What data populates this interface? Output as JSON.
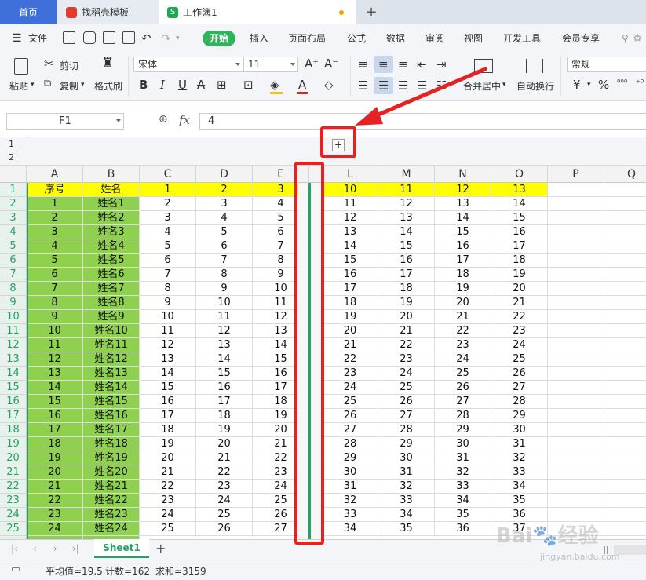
{
  "titlebar": {
    "tabs": [
      {
        "label": "首页"
      },
      {
        "label": "找稻壳模板"
      },
      {
        "label": "工作簿1"
      }
    ],
    "new_tab": "+"
  },
  "menu": {
    "file": "文件",
    "items": [
      "开始",
      "插入",
      "页面布局",
      "公式",
      "数据",
      "审阅",
      "视图",
      "开发工具",
      "会员专享"
    ],
    "search_partial": "查"
  },
  "ribbon": {
    "paste": "粘贴",
    "cut": "剪切",
    "copy": "复制",
    "format_painter": "格式刷",
    "font_name": "宋体",
    "font_size": "11",
    "merge_center": "合并居中",
    "wrap_text": "自动换行",
    "number_format": "常规"
  },
  "formula_bar": {
    "name_box": "F1",
    "fx": "fx",
    "value": "4"
  },
  "outline": {
    "levels": [
      "1",
      "2"
    ],
    "expand": "+"
  },
  "grid": {
    "columns": [
      "A",
      "B",
      "C",
      "D",
      "E",
      "L",
      "M",
      "N",
      "O",
      "P",
      "Q"
    ],
    "header_row": [
      "序号",
      "姓名",
      "1",
      "2",
      "3",
      "10",
      "11",
      "12",
      "13"
    ],
    "rows": [
      [
        "1",
        "姓名1",
        "2",
        "3",
        "4",
        "11",
        "12",
        "13",
        "14"
      ],
      [
        "2",
        "姓名2",
        "3",
        "4",
        "5",
        "12",
        "13",
        "14",
        "15"
      ],
      [
        "3",
        "姓名3",
        "4",
        "5",
        "6",
        "13",
        "14",
        "15",
        "16"
      ],
      [
        "4",
        "姓名4",
        "5",
        "6",
        "7",
        "14",
        "15",
        "16",
        "17"
      ],
      [
        "5",
        "姓名5",
        "6",
        "7",
        "8",
        "15",
        "16",
        "17",
        "18"
      ],
      [
        "6",
        "姓名6",
        "7",
        "8",
        "9",
        "16",
        "17",
        "18",
        "19"
      ],
      [
        "7",
        "姓名7",
        "8",
        "9",
        "10",
        "17",
        "18",
        "19",
        "20"
      ],
      [
        "8",
        "姓名8",
        "9",
        "10",
        "11",
        "18",
        "19",
        "20",
        "21"
      ],
      [
        "9",
        "姓名9",
        "10",
        "11",
        "12",
        "19",
        "20",
        "21",
        "22"
      ],
      [
        "10",
        "姓名10",
        "11",
        "12",
        "13",
        "20",
        "21",
        "22",
        "23"
      ],
      [
        "11",
        "姓名11",
        "12",
        "13",
        "14",
        "21",
        "22",
        "23",
        "24"
      ],
      [
        "12",
        "姓名12",
        "13",
        "14",
        "15",
        "22",
        "23",
        "24",
        "25"
      ],
      [
        "13",
        "姓名13",
        "14",
        "15",
        "16",
        "23",
        "24",
        "25",
        "26"
      ],
      [
        "14",
        "姓名14",
        "15",
        "16",
        "17",
        "24",
        "25",
        "26",
        "27"
      ],
      [
        "15",
        "姓名15",
        "16",
        "17",
        "18",
        "25",
        "26",
        "27",
        "28"
      ],
      [
        "16",
        "姓名16",
        "17",
        "18",
        "19",
        "26",
        "27",
        "28",
        "29"
      ],
      [
        "17",
        "姓名17",
        "18",
        "19",
        "20",
        "27",
        "28",
        "29",
        "30"
      ],
      [
        "18",
        "姓名18",
        "19",
        "20",
        "21",
        "28",
        "29",
        "30",
        "31"
      ],
      [
        "19",
        "姓名19",
        "20",
        "21",
        "22",
        "29",
        "30",
        "31",
        "32"
      ],
      [
        "20",
        "姓名20",
        "21",
        "22",
        "23",
        "30",
        "31",
        "32",
        "33"
      ],
      [
        "21",
        "姓名21",
        "22",
        "23",
        "24",
        "31",
        "32",
        "33",
        "34"
      ],
      [
        "22",
        "姓名22",
        "23",
        "24",
        "25",
        "32",
        "33",
        "34",
        "35"
      ],
      [
        "23",
        "姓名23",
        "24",
        "25",
        "26",
        "33",
        "34",
        "35",
        "36"
      ],
      [
        "24",
        "姓名24",
        "25",
        "26",
        "27",
        "34",
        "35",
        "36",
        "37"
      ]
    ]
  },
  "sheets": {
    "active": "Sheet1",
    "add": "+"
  },
  "status": {
    "average": "平均值=19.5",
    "count": "计数=162",
    "sum": "求和=3159"
  },
  "colors": {
    "accent": "#2fb45c",
    "highlight_green": "#8fd14f",
    "highlight_yellow": "#ffff00",
    "annotation_red": "#e52222",
    "home_tab": "#3f6fd8"
  }
}
